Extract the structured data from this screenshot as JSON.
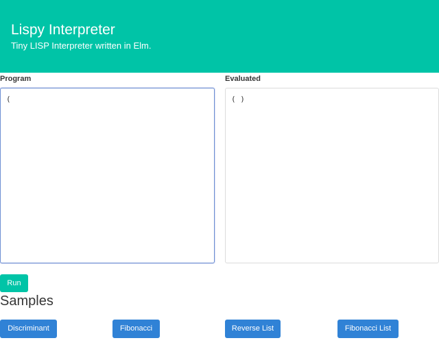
{
  "header": {
    "title": "Lispy Interpreter",
    "subtitle": "Tiny LISP Interpreter written in Elm."
  },
  "program": {
    "label": "Program",
    "value": "("
  },
  "evaluated": {
    "label": "Evaluated",
    "value": "( )"
  },
  "run_button": {
    "label": "Run"
  },
  "samples": {
    "heading": "Samples",
    "buttons": [
      {
        "label": "Discriminant"
      },
      {
        "label": "Fibonacci"
      },
      {
        "label": "Reverse List"
      },
      {
        "label": "Fibonacci List"
      }
    ]
  },
  "colors": {
    "hero": "#00c4a7",
    "run_button": "#00c4a7",
    "sample_button": "#3082d6"
  }
}
